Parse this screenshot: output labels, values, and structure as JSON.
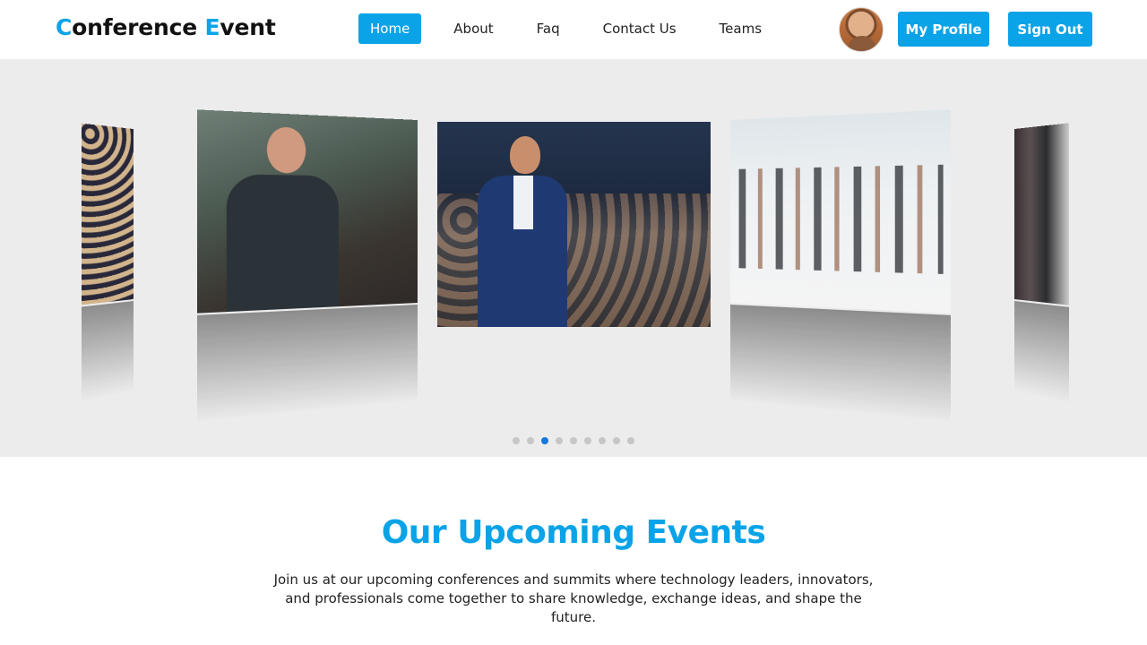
{
  "brand": {
    "first_letter": "C",
    "first_rest": "onference ",
    "second_letter": "E",
    "second_rest": "vent"
  },
  "nav": {
    "home": "Home",
    "about": "About",
    "faq": "Faq",
    "contact": "Contact Us",
    "teams": "Teams"
  },
  "header_actions": {
    "profile_label": "My Profile",
    "signout_label": "Sign Out",
    "avatar_icon": "user-avatar"
  },
  "carousel": {
    "slide_count": 9,
    "active_index": 2,
    "slides": [
      {
        "icon": "audience-photo"
      },
      {
        "icon": "speaker-photo"
      },
      {
        "icon": "speaker-with-microphone-photo"
      },
      {
        "icon": "networking-event-photo"
      },
      {
        "icon": "people-standing-photo"
      }
    ]
  },
  "events": {
    "title": "Our Upcoming Events",
    "description": "Join us at our upcoming conferences and summits where technology leaders, innovators, and professionals come together to share knowledge, exchange ideas, and shape the future."
  },
  "colors": {
    "accent": "#0aa3e8",
    "active_dot": "#1677e0",
    "carousel_bg": "#ececec"
  }
}
